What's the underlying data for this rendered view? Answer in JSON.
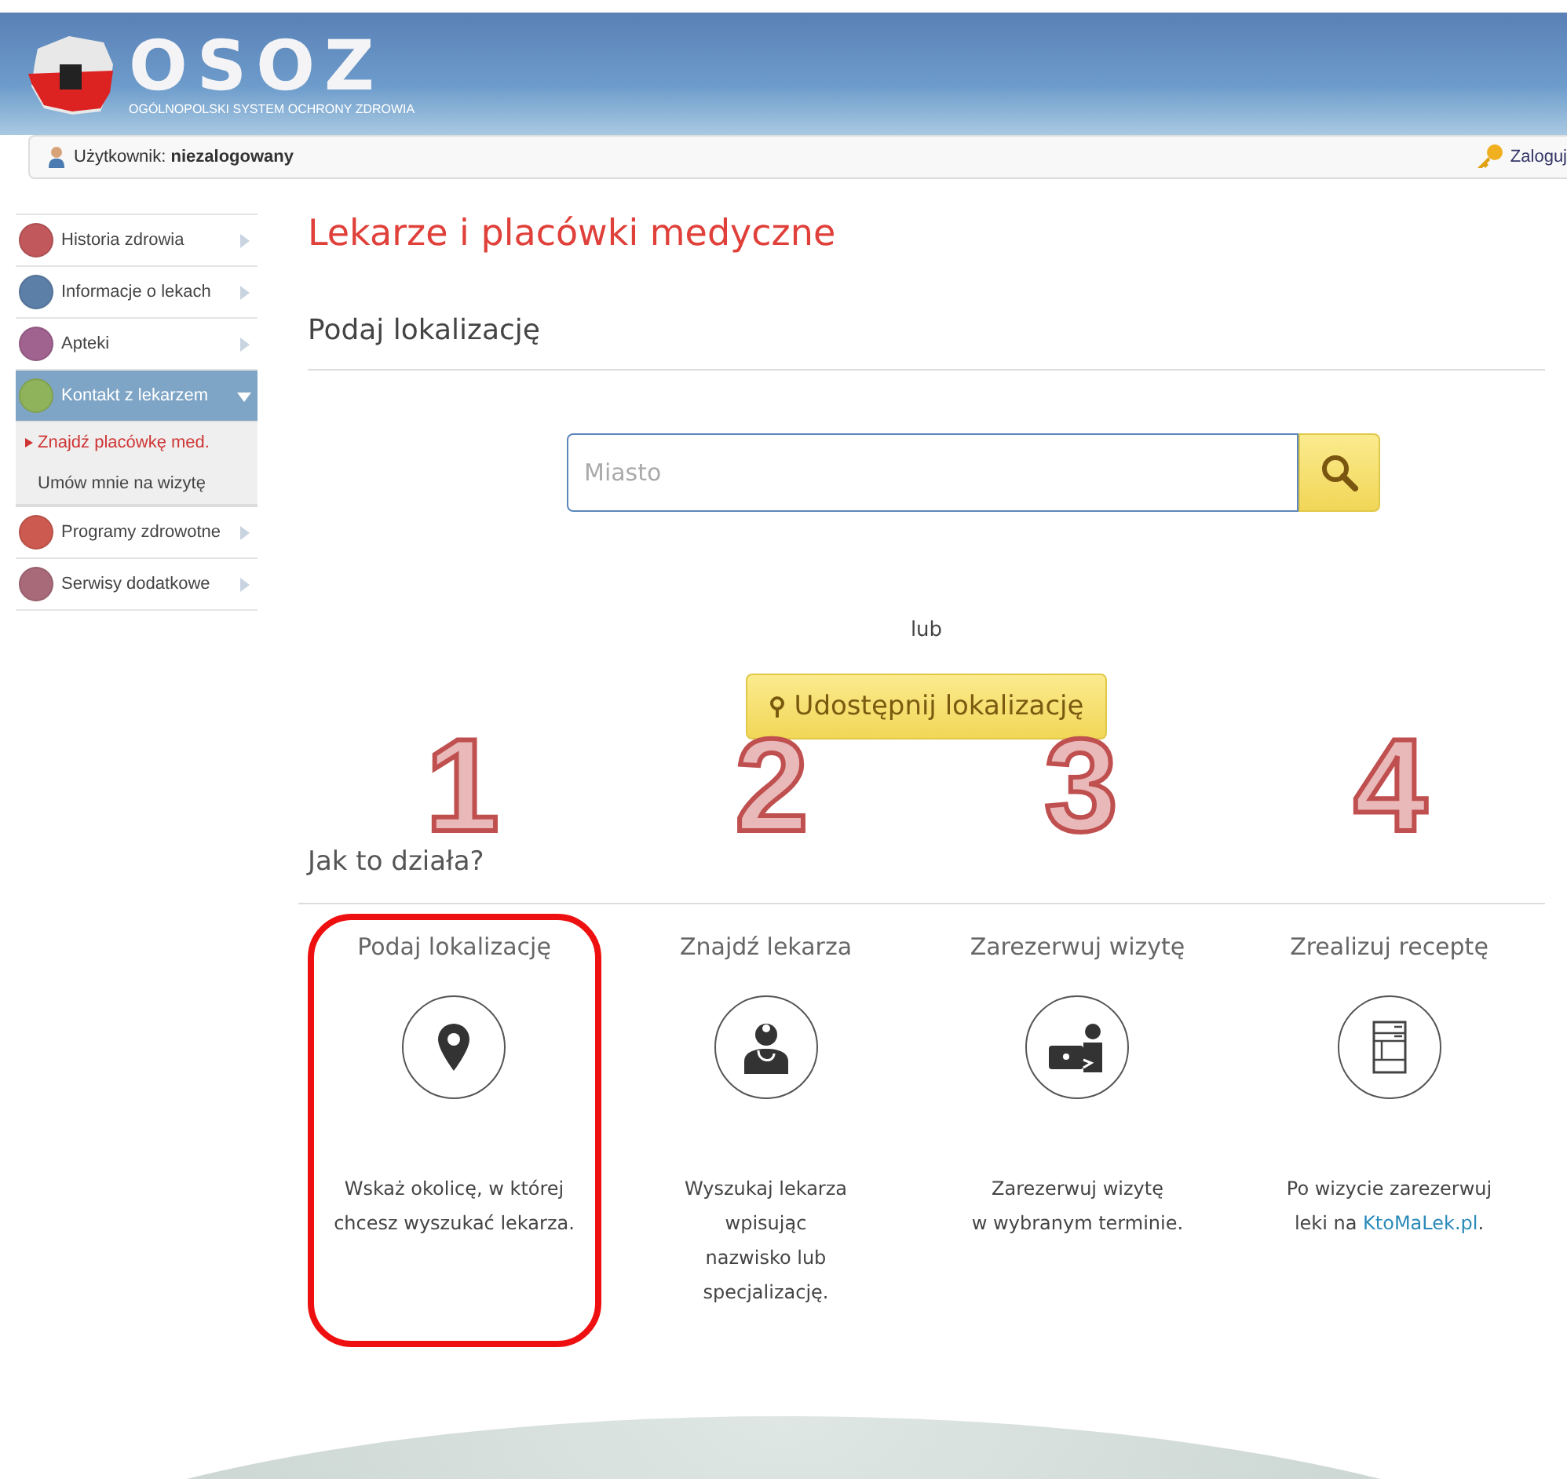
{
  "header": {
    "logo_text": "OSOZ",
    "logo_subtitle": "OGÓLNOPOLSKI SYSTEM OCHRONY ZDROWIA"
  },
  "user_bar": {
    "user": "Użytkownik: **niezalogowany**",
    "login": "Zaloguj"
  },
  "sidebar": {
    "items": [
      {
        "label": "Historia zdrowia",
        "color": "#c0585c",
        "expanded": false
      },
      {
        "label": "Informacje o lekach",
        "color": "#5c7fa8",
        "expanded": false
      },
      {
        "label": "Apteki",
        "color": "#a0628f",
        "expanded": false
      },
      {
        "label": "Kontakt z lekarzem",
        "color": "#8fb35a",
        "expanded": true,
        "children": [
          {
            "label": "Znajdź placówkę med.",
            "selected": true
          },
          {
            "label": "Umów mnie na wizytę",
            "selected": false
          }
        ]
      },
      {
        "label": "Programy zdrowotne",
        "color": "#cc5a50",
        "expanded": false
      },
      {
        "label": "Serwisy dodatkowe",
        "color": "#a86a78",
        "expanded": false
      }
    ]
  },
  "page_title": "Lekarze i placówki medyczne",
  "location": {
    "heading": "Podaj lokalizację",
    "search_placeholder": "Miasto",
    "or": "lub",
    "share_button": "Udostępnij lokalizację"
  },
  "annotations": [
    "1",
    "2",
    "3",
    "4"
  ],
  "how_it_works": {
    "heading": "Jak to działa?",
    "steps": [
      {
        "title": "Podaj lokalizację",
        "kind": "pin",
        "highlighted": true,
        "description": "Wskaż okolicę, w której\nchcesz wyszukać lekarza."
      },
      {
        "title": "Znajdź lekarza",
        "kind": "doctor",
        "highlighted": false,
        "description": "Wyszukaj lekarza\nwpisując\nnazwisko lub\nspecjalizację."
      },
      {
        "title": "Zarezerwuj wizytę",
        "kind": "laptop",
        "highlighted": false,
        "description": "Zarezerwuj wizytę\nw wybranym terminie."
      },
      {
        "title": "Zrealizuj receptę",
        "kind": "prescription",
        "highlighted": false,
        "description": "Po wizycie zarezerwuj\nleki na ",
        "link": "KtoMaLek.pl",
        "after": "."
      }
    ]
  }
}
